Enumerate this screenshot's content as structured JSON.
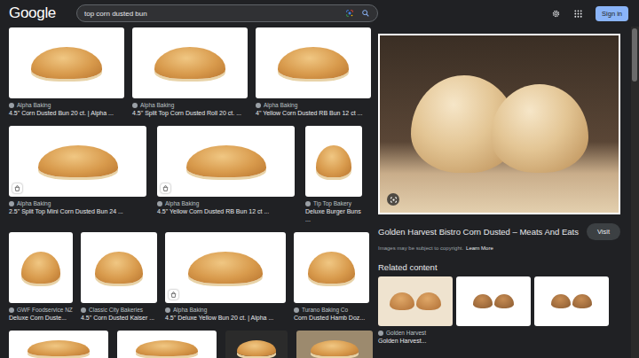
{
  "header": {
    "logo": "Google",
    "query": "top corn dusted bun",
    "sign_in": "Sign in"
  },
  "results": [
    [
      {
        "source": "Alpha Baking",
        "title": "4.5\" Corn Dusted Bun 20 ct. | Alpha ...",
        "product_tag": false
      },
      {
        "source": "Alpha Baking",
        "title": "4.5\" Split Top Corn Dusted Roll 20 ct. ...",
        "product_tag": false
      },
      {
        "source": "Alpha Baking",
        "title": "4\" Yellow Corn Dusted RB Bun 12 ct ...",
        "product_tag": false
      }
    ],
    [
      {
        "source": "Alpha Baking",
        "title": "2.5\" Split Top Mini Corn Dusted Bun 24 ...",
        "product_tag": true
      },
      {
        "source": "Alpha Baking",
        "title": "4.5\" Yellow Corn Dusted RB Bun 12 ct ...",
        "product_tag": true
      },
      {
        "source": "Tip Top Bakery",
        "title": "Deluxe Burger Buns ...",
        "product_tag": false
      }
    ],
    [
      {
        "source": "GWF Foodservice NZ",
        "title": "Deluxe Corn Duste...",
        "product_tag": false
      },
      {
        "source": "Classic City Bakeries",
        "title": "4.5\" Corn Dusted Kaiser ...",
        "product_tag": false
      },
      {
        "source": "Alpha Baking",
        "title": "4.5\" Deluxe Yellow Bun 20 ct. | Alpha ...",
        "product_tag": true
      },
      {
        "source": "Turano Baking Co",
        "title": "Corn Dusted Hamb Doz...",
        "product_tag": false
      }
    ]
  ],
  "preview": {
    "title": "Golden Harvest Bistro Corn Dusted – Meats And Eats",
    "visit": "Visit",
    "copyright": "Images may be subject to copyright.",
    "learn_more": "Learn More",
    "related_heading": "Related content",
    "related": [
      {
        "source": "Golden Harvest",
        "title": "Golden Harvest..."
      },
      {
        "source": "",
        "title": ""
      },
      {
        "source": "",
        "title": ""
      }
    ]
  }
}
